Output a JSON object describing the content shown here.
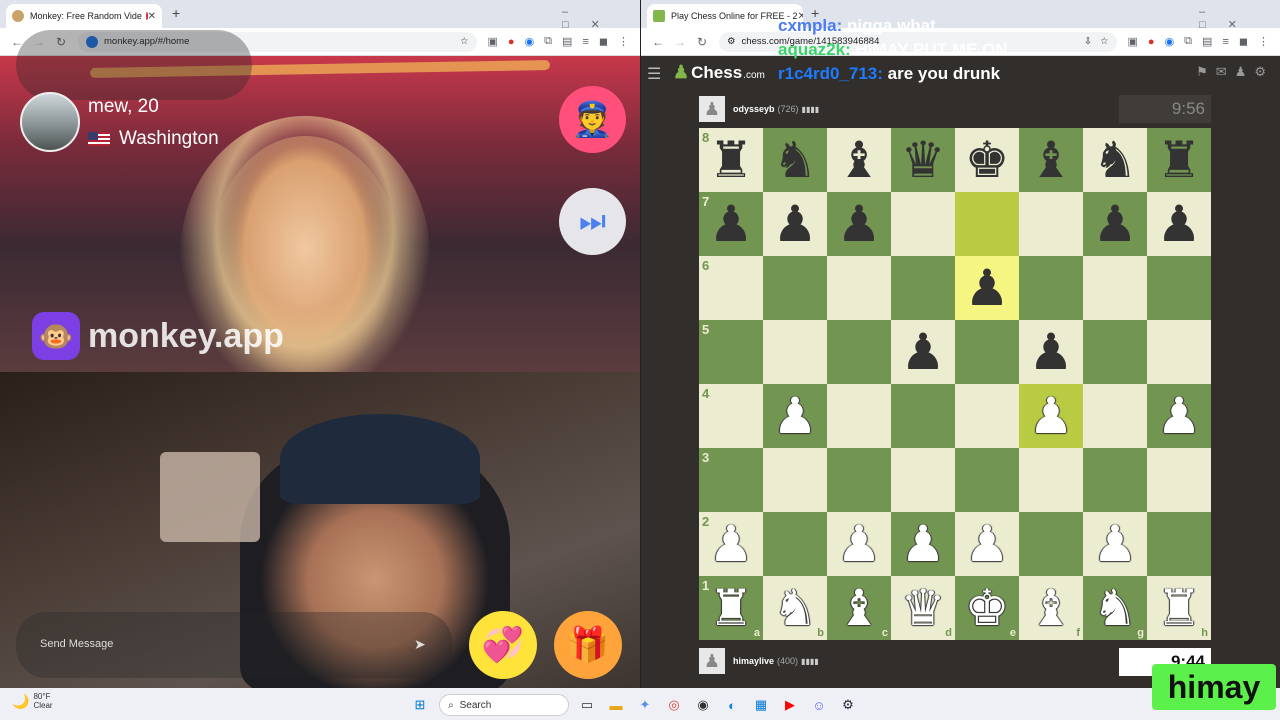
{
  "left_window": {
    "tab_title": "Monkey: Free Random Vide",
    "address": "monkey.app/#/home",
    "peer": {
      "name_age": "mew, 20",
      "location": "Washington"
    },
    "brand": "monkey.app",
    "message_placeholder": "Send Message"
  },
  "right_window": {
    "tab_title": "Play Chess Online for FREE - 2",
    "address": "chess.com/game/141583946884",
    "logo_text": "Chess",
    "logo_suffix": ".com",
    "top_player": {
      "name": "odysseyb",
      "rating": "(726)",
      "bars": "▮▮▮▮",
      "clock": "9:56"
    },
    "bottom_player": {
      "name": "himaylive",
      "rating": "(400)",
      "bars": "▮▮▮▮",
      "clock": "9:44"
    },
    "board": {
      "ranks": [
        "8",
        "7",
        "6",
        "5",
        "4",
        "3",
        "2",
        "1"
      ],
      "files": [
        "a",
        "b",
        "c",
        "d",
        "e",
        "f",
        "g",
        "h"
      ],
      "position": [
        [
          "br",
          "bn",
          "bb",
          "bq",
          "bk",
          "bb",
          "bn",
          "br"
        ],
        [
          "bp",
          "bp",
          "bp",
          "",
          "",
          "",
          "bp",
          "bp"
        ],
        [
          "",
          "",
          "",
          "",
          "bp",
          "",
          "",
          ""
        ],
        [
          "",
          "",
          "",
          "bp",
          "",
          "bp",
          "",
          ""
        ],
        [
          "",
          "wp",
          "",
          "",
          "",
          "wp",
          "",
          "wp"
        ],
        [
          "",
          "",
          "",
          "",
          "",
          "",
          "",
          ""
        ],
        [
          "wp",
          "",
          "wp",
          "wp",
          "wp",
          "",
          "wp",
          ""
        ],
        [
          "wr",
          "wn",
          "wb",
          "wq",
          "wk",
          "wb",
          "wn",
          "wr"
        ]
      ],
      "highlights": [
        "e7",
        "e6",
        "f4"
      ]
    }
  },
  "chat_overlay": [
    {
      "user": "cxmpla:",
      "text": " nigga what",
      "color": "#4a7cf0"
    },
    {
      "user": "aquaz2k:",
      "text": " HIMAY PUT ME ON",
      "color": "#3cd46a"
    },
    {
      "user": "r1c4rd0_713:",
      "text": " are you drunk",
      "color": "#1e7bff"
    }
  ],
  "streamer_badge": "himay",
  "taskbar": {
    "weather_temp": "80°F",
    "weather_desc": "Clear",
    "search_label": "Search"
  }
}
